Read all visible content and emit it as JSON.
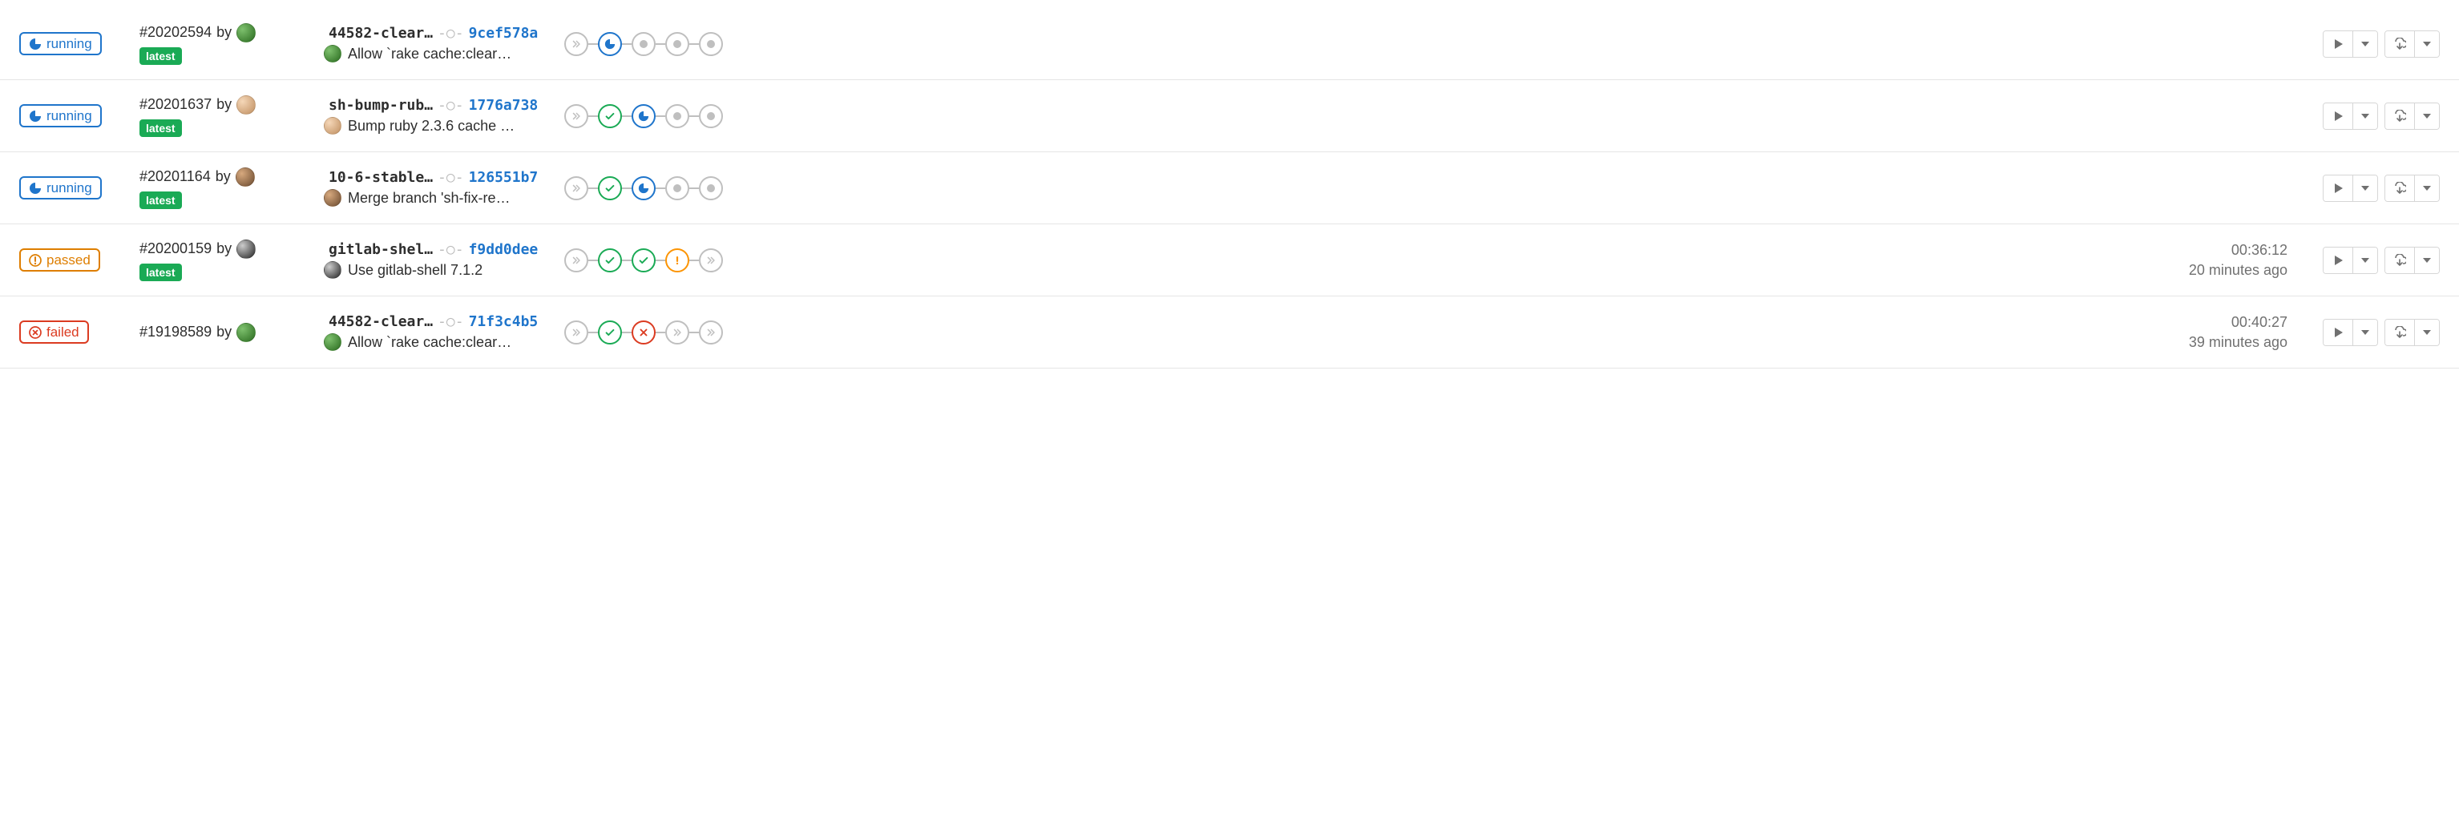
{
  "by_text": "by",
  "latest_label": "latest",
  "status_labels": {
    "running": "running",
    "passed": "passed",
    "failed": "failed"
  },
  "pipelines": [
    {
      "status": "running",
      "id": "#20202594",
      "avatar": "green",
      "latest": true,
      "branch": "44582-clear…",
      "sha": "9cef578a",
      "commit_avatar": "green",
      "message": "Allow `rake cache:clear…",
      "stages": [
        "collapsed",
        "running",
        "pending",
        "pending",
        "pending"
      ],
      "duration": "",
      "finished": ""
    },
    {
      "status": "running",
      "id": "#20201637",
      "avatar": "flesh",
      "latest": true,
      "branch": "sh-bump-rub…",
      "sha": "1776a738",
      "commit_avatar": "flesh",
      "message": "Bump ruby 2.3.6 cache …",
      "stages": [
        "collapsed",
        "passed",
        "running",
        "pending",
        "pending"
      ],
      "duration": "",
      "finished": ""
    },
    {
      "status": "running",
      "id": "#20201164",
      "avatar": "brown",
      "latest": true,
      "branch": "10-6-stable…",
      "sha": "126551b7",
      "commit_avatar": "brown",
      "message": "Merge branch 'sh-fix-re…",
      "stages": [
        "collapsed",
        "passed",
        "running",
        "pending",
        "pending"
      ],
      "duration": "",
      "finished": ""
    },
    {
      "status": "passed",
      "id": "#20200159",
      "avatar": "dark",
      "latest": true,
      "branch": "gitlab-shel…",
      "sha": "f9dd0dee",
      "commit_avatar": "dark",
      "message": "Use gitlab-shell 7.1.2",
      "stages": [
        "collapsed",
        "passed",
        "passed",
        "warning",
        "collapsed"
      ],
      "duration": "00:36:12",
      "finished": "20 minutes ago"
    },
    {
      "status": "failed",
      "id": "#19198589",
      "id_display": "#19198589",
      "avatar": "green",
      "latest": false,
      "branch": "44582-clear…",
      "sha": "71f3c4b5",
      "commit_avatar": "green",
      "message": "Allow `rake cache:clear…",
      "stages": [
        "collapsed",
        "passed",
        "failed",
        "collapsed",
        "collapsed"
      ],
      "duration": "00:40:27",
      "finished": "39 minutes ago"
    }
  ]
}
